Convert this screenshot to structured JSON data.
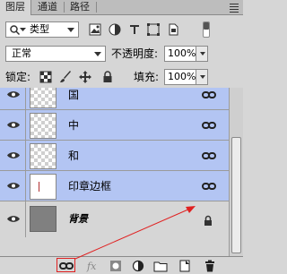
{
  "tabs": [
    {
      "label": "图层",
      "active": true
    },
    {
      "label": "通道",
      "active": false
    },
    {
      "label": "路径",
      "active": false
    }
  ],
  "filter": {
    "kind_label": "类型"
  },
  "blend": {
    "mode": "正常",
    "opacity_label": "不透明度:",
    "opacity_value": "100%"
  },
  "lock": {
    "label": "锁定:",
    "fill_label": "填充:",
    "fill_value": "100%"
  },
  "layers": [
    {
      "name": "国",
      "selected": true,
      "linked": true,
      "thumb": "transparent"
    },
    {
      "name": "中",
      "selected": true,
      "linked": true,
      "thumb": "transparent"
    },
    {
      "name": "和",
      "selected": true,
      "linked": true,
      "thumb": "transparent"
    },
    {
      "name": "印章边框",
      "selected": true,
      "linked": true,
      "thumb": "white"
    },
    {
      "name": "背景",
      "selected": false,
      "locked": true,
      "thumb": "gray"
    }
  ],
  "colors": {
    "selected_row": "#b3c5f3",
    "annotation_arrow": "#e02020"
  },
  "bottom_icons": [
    "link-icon",
    "fx-icon",
    "mask-icon",
    "adjustment-icon",
    "group-icon",
    "new-layer-icon",
    "trash-icon"
  ]
}
